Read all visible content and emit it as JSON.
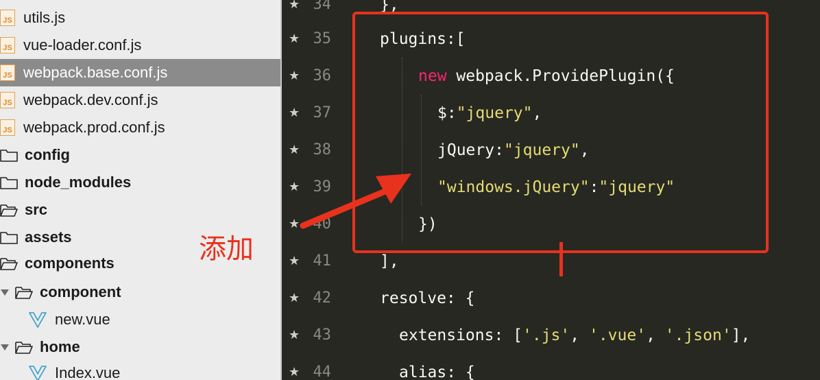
{
  "sidebar": {
    "items": [
      {
        "label": "utils.js",
        "icon": "js-file-icon"
      },
      {
        "label": "vue-loader.conf.js",
        "icon": "js-file-icon"
      },
      {
        "label": "webpack.base.conf.js",
        "icon": "js-file-icon",
        "selected": true
      },
      {
        "label": "webpack.dev.conf.js",
        "icon": "js-file-icon"
      },
      {
        "label": "webpack.prod.conf.js",
        "icon": "js-file-icon"
      },
      {
        "label": "config",
        "icon": "folder-icon"
      },
      {
        "label": "node_modules",
        "icon": "folder-icon"
      },
      {
        "label": "src",
        "icon": "folder-open-icon"
      },
      {
        "label": "assets",
        "icon": "folder-icon"
      },
      {
        "label": "components",
        "icon": "folder-open-icon"
      },
      {
        "label": "component",
        "icon": "folder-open-icon"
      },
      {
        "label": "new.vue",
        "icon": "vue-file-icon"
      },
      {
        "label": "home",
        "icon": "folder-open-icon"
      },
      {
        "label": "Index.vue",
        "icon": "vue-file-icon"
      }
    ],
    "js_icon_text": "JS"
  },
  "editor": {
    "star_glyph": "★",
    "lines": [
      {
        "num": "34",
        "tokens": [
          {
            "t": "},",
            "c": "plain"
          }
        ]
      },
      {
        "num": "35",
        "tokens": [
          {
            "t": "plugins:[",
            "c": "plain"
          }
        ]
      },
      {
        "num": "36",
        "tokens": [
          {
            "t": "new",
            "c": "kw"
          },
          {
            "t": " webpack.ProvidePlugin({",
            "c": "plain"
          }
        ]
      },
      {
        "num": "37",
        "tokens": [
          {
            "t": "$:",
            "c": "plain"
          },
          {
            "t": "\"jquery\"",
            "c": "str"
          },
          {
            "t": ",",
            "c": "plain"
          }
        ]
      },
      {
        "num": "38",
        "tokens": [
          {
            "t": "jQuery:",
            "c": "plain"
          },
          {
            "t": "\"jquery\"",
            "c": "str"
          },
          {
            "t": ",",
            "c": "plain"
          }
        ]
      },
      {
        "num": "39",
        "tokens": [
          {
            "t": "\"windows.jQuery\"",
            "c": "str"
          },
          {
            "t": ":",
            "c": "plain"
          },
          {
            "t": "\"jquery\"",
            "c": "str"
          }
        ]
      },
      {
        "num": "40",
        "tokens": [
          {
            "t": "})",
            "c": "plain"
          }
        ]
      },
      {
        "num": "41",
        "tokens": [
          {
            "t": "],",
            "c": "plain"
          }
        ]
      },
      {
        "num": "42",
        "tokens": [
          {
            "t": "resolve: {",
            "c": "plain"
          }
        ]
      },
      {
        "num": "43",
        "tokens": [
          {
            "t": "extensions: [",
            "c": "plain"
          },
          {
            "t": "'.js'",
            "c": "str"
          },
          {
            "t": ", ",
            "c": "plain"
          },
          {
            "t": "'.vue'",
            "c": "str"
          },
          {
            "t": ", ",
            "c": "plain"
          },
          {
            "t": "'.json'",
            "c": "str"
          },
          {
            "t": "],",
            "c": "plain"
          }
        ]
      },
      {
        "num": "44",
        "tokens": [
          {
            "t": "alias: {",
            "c": "plain"
          }
        ]
      }
    ]
  },
  "annotation": {
    "label": "添加",
    "color": "#e8321e"
  },
  "colors": {
    "keyword": "#f92672",
    "string": "#e6db74",
    "plain": "#f8f8f2",
    "editor_bg": "#272822",
    "sidebar_bg": "#ececec",
    "selected_bg": "#8b8b8b"
  }
}
